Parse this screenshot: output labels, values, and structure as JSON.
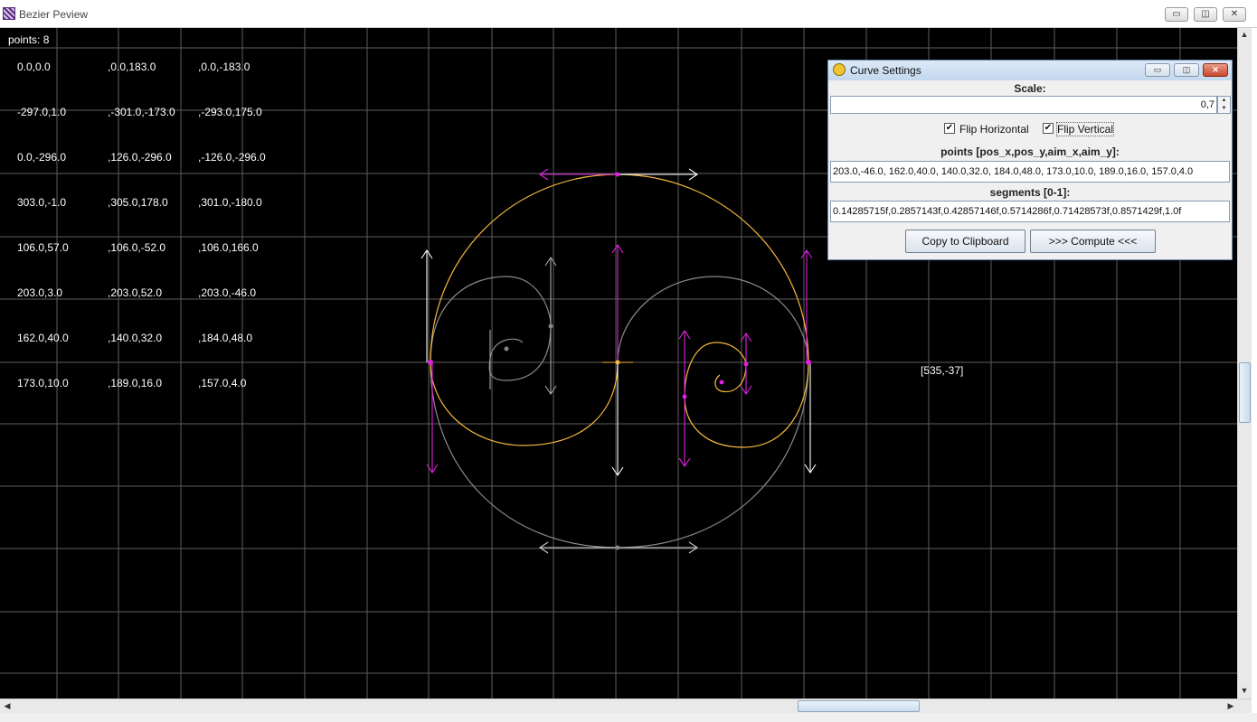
{
  "window": {
    "title": "Bezier Peview",
    "icon": "app-icon",
    "controls": {
      "minimize": "▭",
      "maximize": "◫",
      "close": "✕"
    }
  },
  "canvas": {
    "points_label": "points: 8",
    "cursor_readout": "[535,-37]",
    "point_rows": [
      [
        "0.0,0.0",
        ",0.0,183.0",
        ",0.0,-183.0"
      ],
      [
        "-297.0,1.0",
        ",-301.0,-173.0",
        ",-293.0,175.0"
      ],
      [
        "0.0,-296.0",
        ",126.0,-296.0",
        ",-126.0,-296.0"
      ],
      [
        "303.0,-1.0",
        ",305.0,178.0",
        ",301.0,-180.0"
      ],
      [
        "106.0,57.0",
        ",106.0,-52.0",
        ",106.0,166.0"
      ],
      [
        "203.0,3.0",
        ",203.0,52.0",
        ",203.0,-46.0"
      ],
      [
        "162.0,40.0",
        ",140.0,32.0",
        ",184.0,48.0"
      ],
      [
        "173.0,10.0",
        ",189.0,16.0",
        ",157.0,4.0"
      ]
    ],
    "colors": {
      "background": "#000000",
      "grid": "#6e6e6e",
      "curve": "#f5b83c",
      "mirrored_curve": "#8a8a8a",
      "handles": "#e020e0",
      "arrows_white": "#ffffff"
    }
  },
  "dialog": {
    "title": "Curve Settings",
    "scale_label": "Scale:",
    "scale_value": "0,7",
    "flip_horizontal_label": "Flip Horizontal",
    "flip_horizontal_checked": true,
    "flip_vertical_label": "Flip Vertical",
    "flip_vertical_checked": true,
    "points_label": "points [pos_x,pos_y,aim_x,aim_y]:",
    "points_value": "203.0,-46.0, 162.0,40.0, 140.0,32.0, 184.0,48.0, 173.0,10.0, 189.0,16.0, 157.0,4.0",
    "segments_label": "segments [0-1]:",
    "segments_value": "0.14285715f,0.2857143f,0.42857146f,0.5714286f,0.71428573f,0.8571429f,1.0f",
    "copy_button": "Copy to Clipboard",
    "compute_button": ">>>  Compute  <<<",
    "controls": {
      "minimize": "▭",
      "maximize": "◫",
      "close": "✕"
    }
  },
  "scrollbars": {
    "up": "▲",
    "down": "▼",
    "left": "◀",
    "right": "▶"
  }
}
